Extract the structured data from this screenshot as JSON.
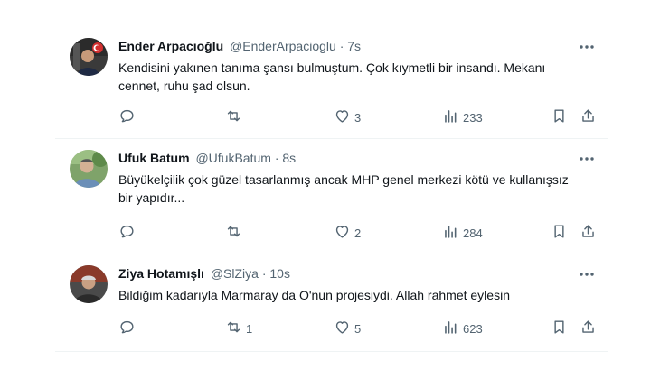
{
  "tweets": [
    {
      "name": "Ender Arpacıoğlu",
      "handle": "@EnderArpacioglu",
      "dot": "·",
      "time": "7s",
      "text": "Kendisini yakınen tanıma şansı bulmuştum. Çok kıymetli bir insandı. Mekanı cennet, ruhu şad olsun.",
      "replies": "",
      "retweets": "",
      "likes": "3",
      "views": "233"
    },
    {
      "name": "Ufuk Batum",
      "handle": "@UfukBatum",
      "dot": "·",
      "time": "8s",
      "text": "Büyükelçilik çok güzel tasarlanmış ancak MHP genel merkezi kötü ve kullanışsız bir yapıdır...",
      "replies": "",
      "retweets": "",
      "likes": "2",
      "views": "284"
    },
    {
      "name": "Ziya Hotamışlı",
      "handle": "@SlZiya",
      "dot": "·",
      "time": "10s",
      "text": "Bildiğim kadarıyla Marmaray da O'nun projesiydi. Allah rahmet eylesin",
      "replies": "",
      "retweets": "1",
      "likes": "5",
      "views": "623"
    }
  ],
  "icons": {
    "reply": "reply-icon",
    "retweet": "retweet-icon",
    "like": "heart-icon",
    "views": "views-icon",
    "bookmark": "bookmark-icon",
    "share": "share-icon",
    "more": "more-icon"
  },
  "colors": {
    "text": "#0f1419",
    "secondary": "#536471",
    "border": "#eff3f4"
  }
}
